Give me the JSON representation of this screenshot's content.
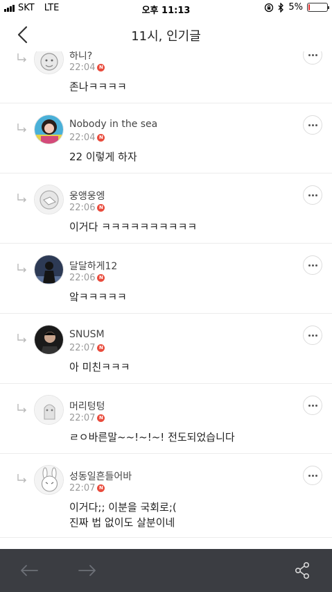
{
  "status_bar": {
    "carrier": "SKT",
    "network": "LTE",
    "time": "오후 11:13",
    "battery": "5%",
    "battery_level": 0.05
  },
  "nav": {
    "title": "11시, 인기글",
    "back_icon": "chevron-left-icon"
  },
  "comments": [
    {
      "username": "하니?",
      "time": "22:04",
      "badge": "N",
      "text": "존나ㅋㅋㅋㅋ",
      "avatar_icon": "cartoon-avatar"
    },
    {
      "username": "Nobody in the sea",
      "time": "22:04",
      "badge": "N",
      "text": "22 이렇게 하자",
      "avatar_icon": "photo-avatar"
    },
    {
      "username": "웅앵웅엥",
      "time": "22:06",
      "badge": "N",
      "text": "이거다 ㅋㅋㅋㅋㅋㅋㅋㅋㅋㅋ",
      "avatar_icon": "cartoon-avatar"
    },
    {
      "username": "달달하게12",
      "time": "22:06",
      "badge": "N",
      "text": "앜ㅋㅋㅋㅋㅋ",
      "avatar_icon": "photo-avatar"
    },
    {
      "username": "SNUSM",
      "time": "22:07",
      "badge": "N",
      "text": "아 미친ㅋㅋㅋ",
      "avatar_icon": "photo-avatar"
    },
    {
      "username": "머리텅텅",
      "time": "22:07",
      "badge": "N",
      "text": "ㄹㅇ바른말~~!~!~! 전도되었습니다",
      "avatar_icon": "cartoon-avatar"
    },
    {
      "username": "성동일흔들어바",
      "time": "22:07",
      "badge": "N",
      "text": "이거다;; 이분을 국회로;(\n진짜 법 없이도 살분이네",
      "avatar_icon": "cartoon-avatar"
    }
  ],
  "toolbar": {
    "back_icon": "arrow-left-icon",
    "forward_icon": "arrow-right-icon",
    "share_icon": "share-icon"
  },
  "colors": {
    "new_badge": "#e94b3c",
    "toolbar_bg": "#3b3d42",
    "divider": "#ececec"
  }
}
